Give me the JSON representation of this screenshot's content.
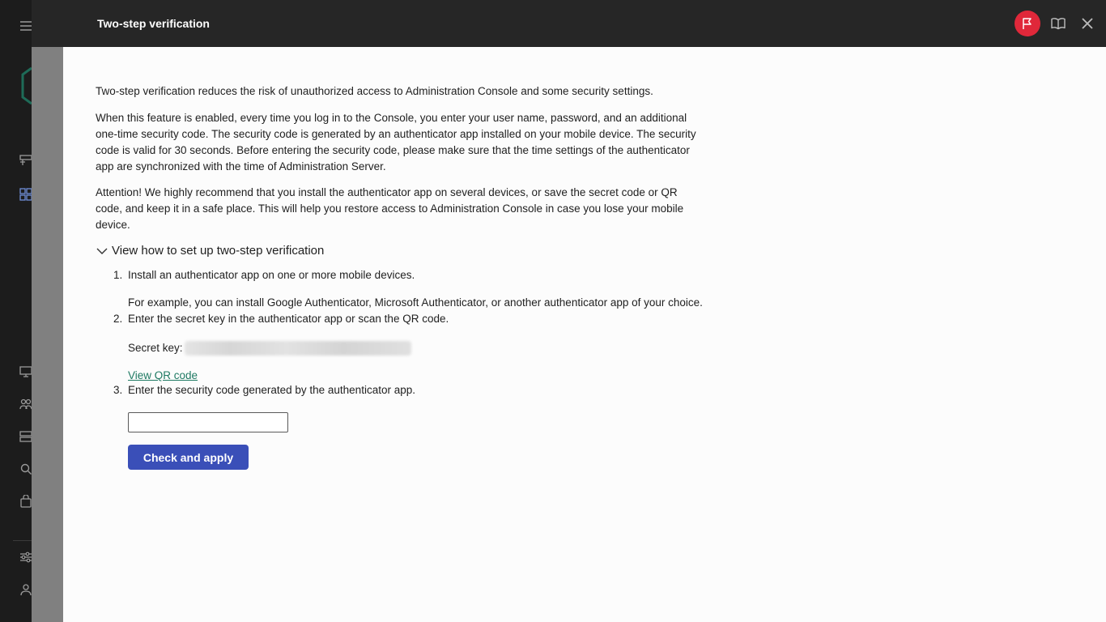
{
  "drawer": {
    "title": "Two-step verification"
  },
  "intro": {
    "p1": "Two-step verification reduces the risk of unauthorized access to Administration Console and some security settings.",
    "p2": "When this feature is enabled, every time you log in to the Console, you enter your user name, password, and an additional one-time security code. The security code is generated by an authenticator app installed on your mobile device. The security code is valid for 30 seconds. Before entering the security code, please make sure that the time settings of the authenticator app are synchronized with the time of Administration Server.",
    "p3": "Attention! We highly recommend that you install the authenticator app on several devices, or save the secret code or QR code, and keep it in a safe place. This will help you restore access to Administration Console in case you lose your mobile device."
  },
  "setup": {
    "expander_label": "View how to set up two-step verification",
    "steps": [
      {
        "num": "1.",
        "text": "Install an authenticator app on one or more mobile devices.",
        "note": "For example, you can install Google Authenticator, Microsoft Authenticator, or another authenticator app of your choice."
      },
      {
        "num": "2.",
        "text": "Enter the secret key in the authenticator app or scan the QR code."
      },
      {
        "num": "3.",
        "text": "Enter the security code generated by the authenticator app."
      }
    ],
    "secret_key_label": "Secret key:",
    "view_qr_label": "View QR code",
    "code_input_value": "",
    "apply_label": "Check and apply"
  },
  "colors": {
    "accent": "#3a4fb8",
    "link": "#1f7a63",
    "flag": "#e0283a",
    "header_bg": "#262626"
  },
  "icons": {
    "rail": [
      "menu-icon",
      "layout-icon",
      "dashboard-icon",
      "monitor-icon",
      "users-icon",
      "server-icon",
      "search-icon",
      "store-icon",
      "sliders-icon",
      "user-icon"
    ],
    "header": [
      "flag-icon",
      "book-icon",
      "close-icon"
    ]
  }
}
